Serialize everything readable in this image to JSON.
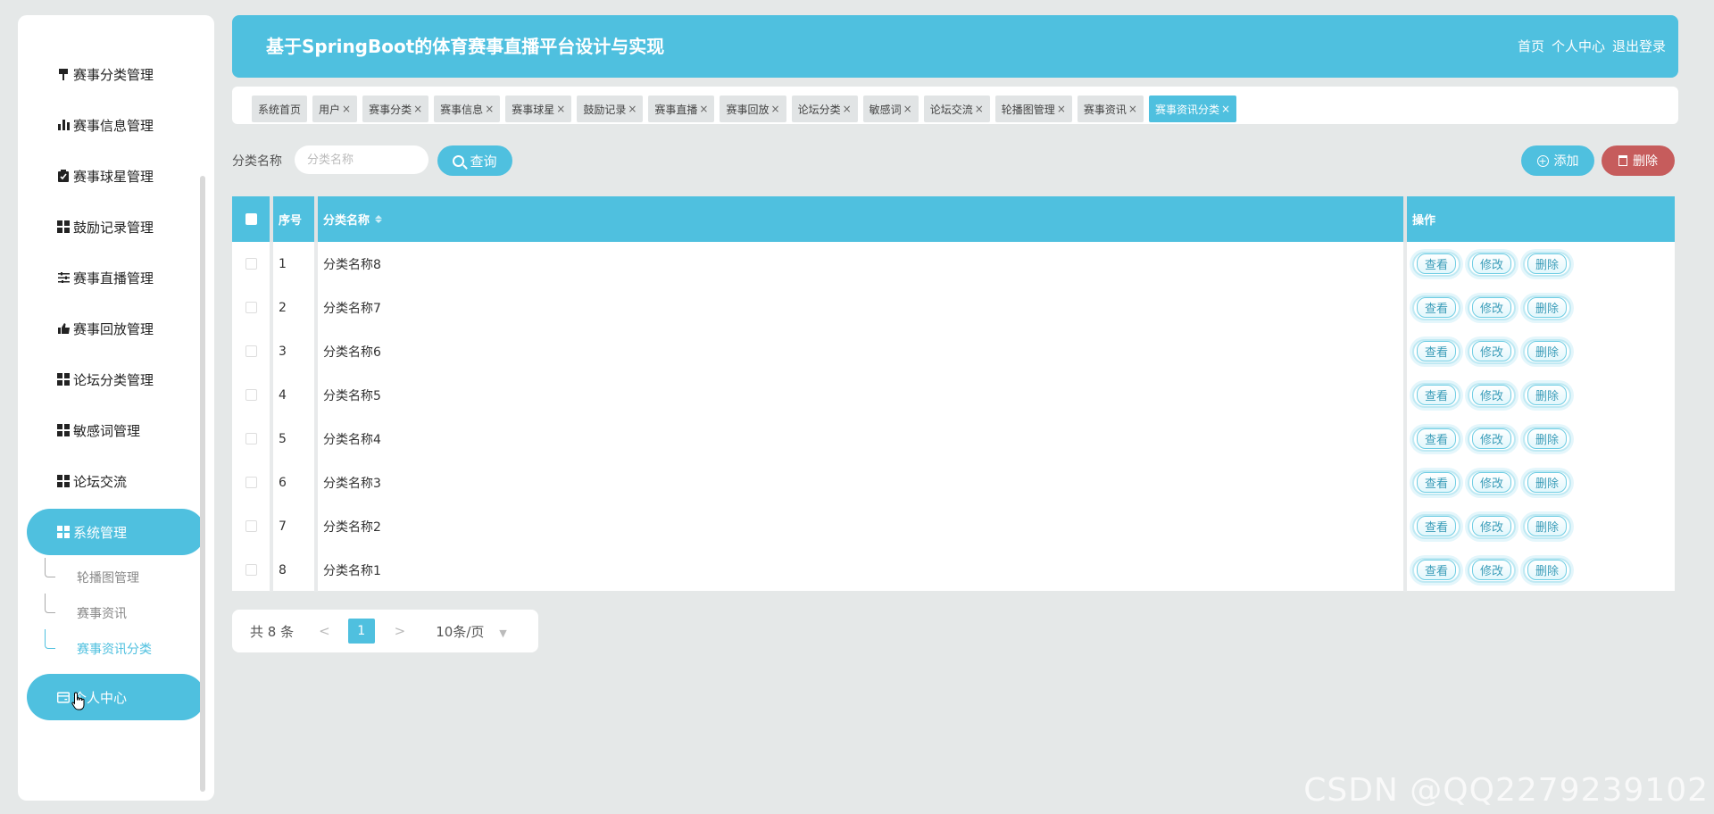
{
  "header": {
    "title": "基于SpringBoot的体育赛事直播平台设计与实现",
    "links": [
      "首页",
      "个人中心",
      "退出登录"
    ]
  },
  "sidebar": {
    "items": [
      {
        "label": "赛事分类管理",
        "icon": "bookmark-icon"
      },
      {
        "label": "赛事信息管理",
        "icon": "bar-chart-icon"
      },
      {
        "label": "赛事球星管理",
        "icon": "clipboard-check-icon"
      },
      {
        "label": "鼓励记录管理",
        "icon": "grid-icon"
      },
      {
        "label": "赛事直播管理",
        "icon": "sliders-icon"
      },
      {
        "label": "赛事回放管理",
        "icon": "thumbs-up-icon"
      },
      {
        "label": "论坛分类管理",
        "icon": "grid-icon"
      },
      {
        "label": "敏感词管理",
        "icon": "grid-icon"
      },
      {
        "label": "论坛交流",
        "icon": "grid-icon"
      },
      {
        "label": "系统管理",
        "icon": "grid-icon"
      }
    ],
    "submenu": [
      {
        "label": "轮播图管理"
      },
      {
        "label": "赛事资讯"
      },
      {
        "label": "赛事资讯分类"
      }
    ],
    "personal": {
      "label": "个人中心",
      "icon": "card-icon"
    }
  },
  "tabs": [
    {
      "label": "系统首页",
      "closable": false
    },
    {
      "label": "用户",
      "closable": true
    },
    {
      "label": "赛事分类",
      "closable": true
    },
    {
      "label": "赛事信息",
      "closable": true
    },
    {
      "label": "赛事球星",
      "closable": true
    },
    {
      "label": "鼓励记录",
      "closable": true
    },
    {
      "label": "赛事直播",
      "closable": true
    },
    {
      "label": "赛事回放",
      "closable": true
    },
    {
      "label": "论坛分类",
      "closable": true
    },
    {
      "label": "敏感词",
      "closable": true
    },
    {
      "label": "论坛交流",
      "closable": true
    },
    {
      "label": "轮播图管理",
      "closable": true
    },
    {
      "label": "赛事资讯",
      "closable": true
    },
    {
      "label": "赛事资讯分类",
      "closable": true
    }
  ],
  "search": {
    "label": "分类名称",
    "placeholder": "分类名称",
    "query_label": "查询",
    "add_label": "添加",
    "delete_label": "删除"
  },
  "table": {
    "columns": [
      "序号",
      "分类名称",
      "操作"
    ],
    "rows": [
      {
        "no": "1",
        "name": "分类名称8"
      },
      {
        "no": "2",
        "name": "分类名称7"
      },
      {
        "no": "3",
        "name": "分类名称6"
      },
      {
        "no": "4",
        "name": "分类名称5"
      },
      {
        "no": "5",
        "name": "分类名称4"
      },
      {
        "no": "6",
        "name": "分类名称3"
      },
      {
        "no": "7",
        "name": "分类名称2"
      },
      {
        "no": "8",
        "name": "分类名称1"
      }
    ],
    "actions": [
      "查看",
      "修改",
      "删除"
    ]
  },
  "pager": {
    "total": "共 8 条",
    "prev": "<",
    "current": "1",
    "next": ">",
    "size": "10条/页"
  },
  "watermark": "CSDN @QQ2279239102",
  "colors": {
    "accent": "#4fc0df",
    "danger": "#c65c5c",
    "background": "#e5e8e8"
  }
}
